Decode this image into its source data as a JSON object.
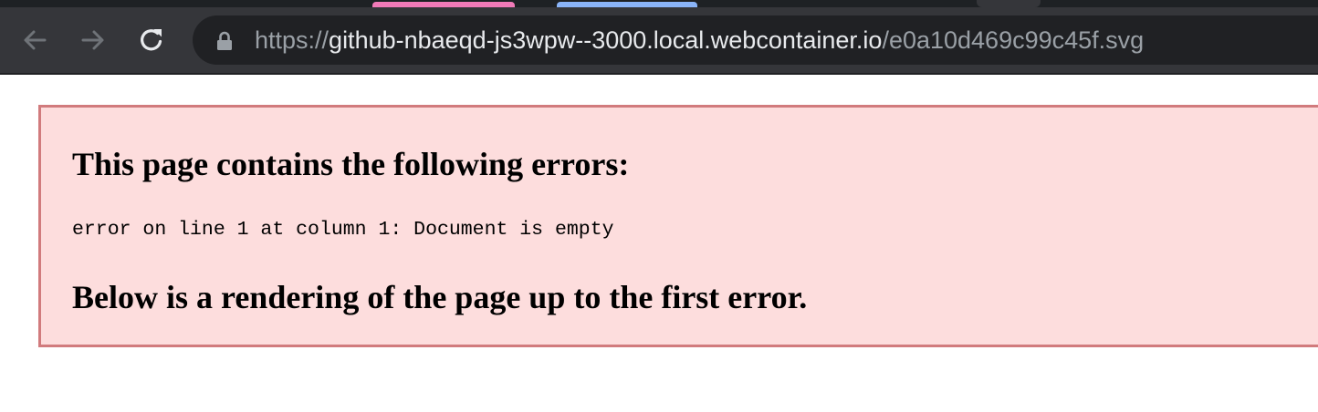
{
  "browser": {
    "tabs": [
      {
        "color": "#f17ab8"
      },
      {
        "color": "#8ab4f8"
      }
    ],
    "toolbar": {
      "back_icon": "arrow-left-icon",
      "forward_icon": "arrow-right-icon",
      "reload_icon": "reload-icon"
    },
    "address_bar": {
      "lock_icon": "lock-icon",
      "url_scheme": "https://",
      "url_host": "github-nbaeqd-js3wpw--3000.local.webcontainer.io",
      "url_path": "/e0a10d469c99c45f.svg"
    },
    "colors": {
      "toolbar_bg": "#35363a",
      "address_bg": "#202124",
      "error_bg": "#fddddd",
      "error_border": "#d17b7d"
    }
  },
  "page": {
    "error": {
      "heading": "This page contains the following errors:",
      "message": "error on line 1 at column 1: Document is empty",
      "footer": "Below is a rendering of the page up to the first error."
    }
  }
}
